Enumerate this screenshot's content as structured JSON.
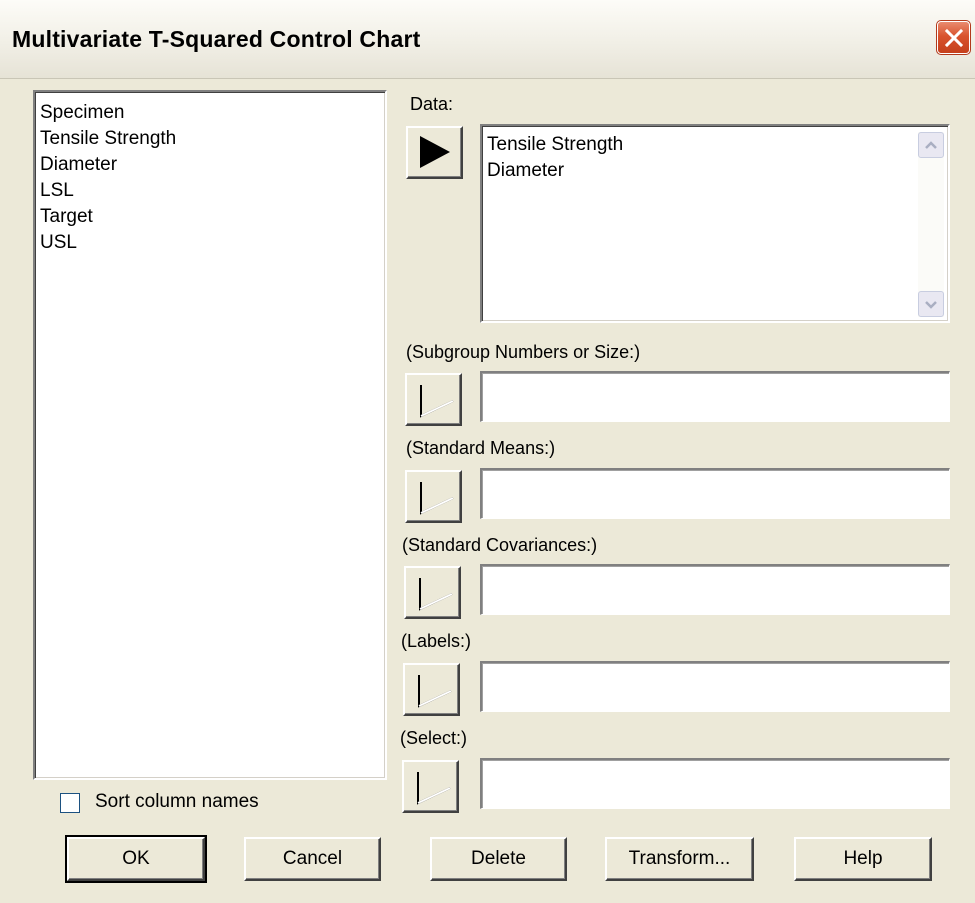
{
  "window": {
    "title": "Multivariate T-Squared Control Chart"
  },
  "variables": {
    "items": [
      "Specimen",
      "Tensile Strength",
      "Diameter",
      "LSL",
      "Target",
      "USL"
    ]
  },
  "sort_columns": {
    "label": "Sort column names",
    "checked": false
  },
  "data": {
    "label": "Data:",
    "items": [
      "Tensile Strength",
      "Diameter"
    ]
  },
  "subgroup": {
    "label": "(Subgroup Numbers or Size:)",
    "value": ""
  },
  "standard_means": {
    "label": "(Standard Means:)",
    "value": ""
  },
  "standard_covariances": {
    "label": "(Standard Covariances:)",
    "value": ""
  },
  "labels": {
    "label": "(Labels:)",
    "value": ""
  },
  "select": {
    "label": "(Select:)",
    "value": ""
  },
  "buttons": {
    "ok": "OK",
    "cancel": "Cancel",
    "delete": "Delete",
    "transform": "Transform...",
    "help": "Help"
  }
}
